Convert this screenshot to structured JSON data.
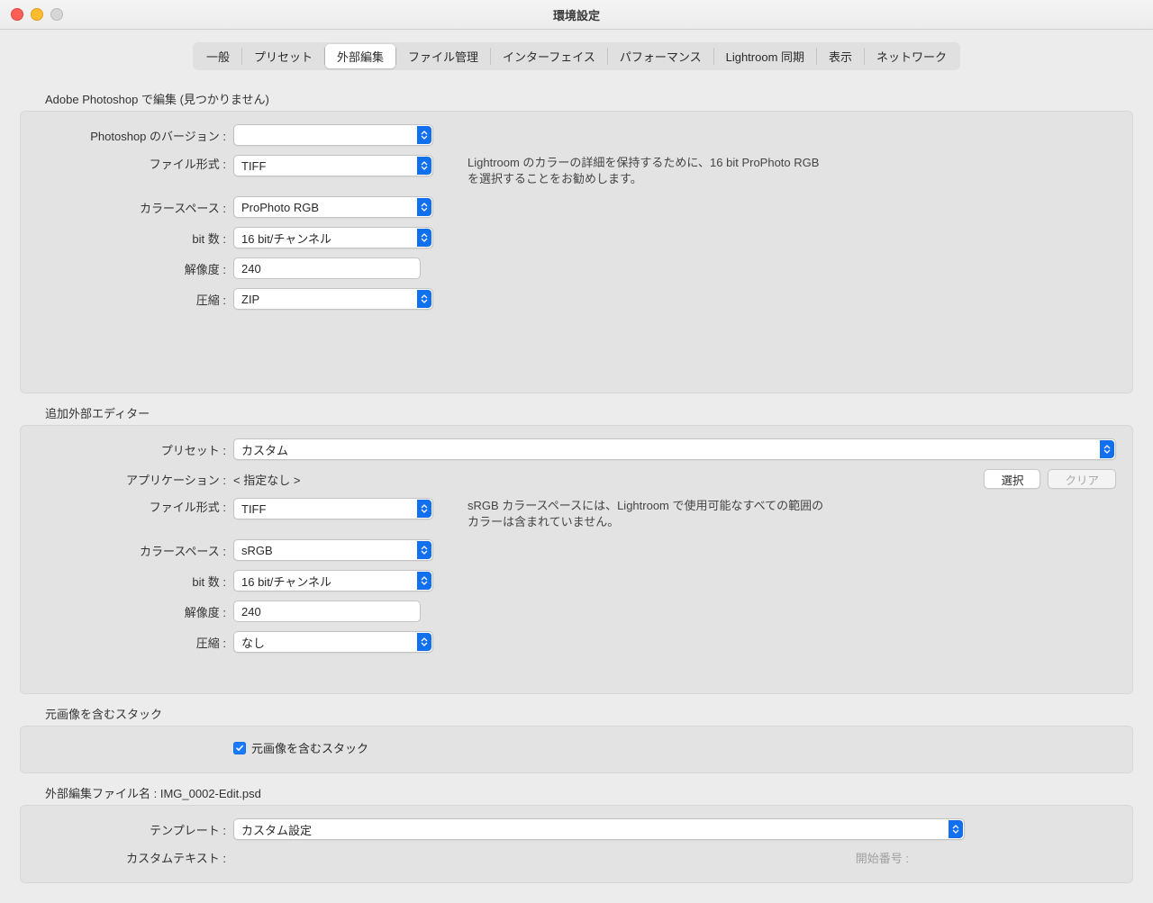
{
  "window": {
    "title": "環境設定"
  },
  "tabs": {
    "general": "一般",
    "presets": "プリセット",
    "external_editing": "外部編集",
    "file_handling": "ファイル管理",
    "interface": "インターフェイス",
    "performance": "パフォーマンス",
    "lightroom_sync": "Lightroom 同期",
    "display": "表示",
    "network": "ネットワーク"
  },
  "ps": {
    "section_title": "Adobe Photoshop で編集 (見つかりません)",
    "version_label": "Photoshop のバージョン :",
    "version_value": "",
    "file_format_label": "ファイル形式 :",
    "file_format_value": "TIFF",
    "color_space_label": "カラースペース :",
    "color_space_value": "ProPhoto RGB",
    "bit_depth_label": "bit 数 :",
    "bit_depth_value": "16 bit/チャンネル",
    "resolution_label": "解像度 :",
    "resolution_value": "240",
    "compression_label": "圧縮 :",
    "compression_value": "ZIP",
    "hint": "Lightroom のカラーの詳細を保持するために、16 bit ProPhoto RGB を選択することをお勧めします。"
  },
  "additional": {
    "section_title": "追加外部エディター",
    "preset_label": "プリセット :",
    "preset_value": "カスタム",
    "application_label": "アプリケーション :",
    "application_value": "< 指定なし >",
    "select_button": "選択",
    "clear_button": "クリア",
    "file_format_label": "ファイル形式 :",
    "file_format_value": "TIFF",
    "color_space_label": "カラースペース :",
    "color_space_value": "sRGB",
    "bit_depth_label": "bit 数 :",
    "bit_depth_value": "16 bit/チャンネル",
    "resolution_label": "解像度 :",
    "resolution_value": "240",
    "compression_label": "圧縮 :",
    "compression_value": "なし",
    "hint": "sRGB カラースペースには、Lightroom で使用可能なすべての範囲のカラーは含まれていません。"
  },
  "stack": {
    "section_title": "元画像を含むスタック",
    "checkbox_label": "元画像を含むスタック"
  },
  "filename": {
    "section_title_prefix": "外部編集ファイル名 : ",
    "section_title_value": "IMG_0002-Edit.psd",
    "template_label": "テンプレート :",
    "template_value": "カスタム設定",
    "custom_text_label": "カスタムテキスト :",
    "start_number_label": "開始番号 :"
  }
}
